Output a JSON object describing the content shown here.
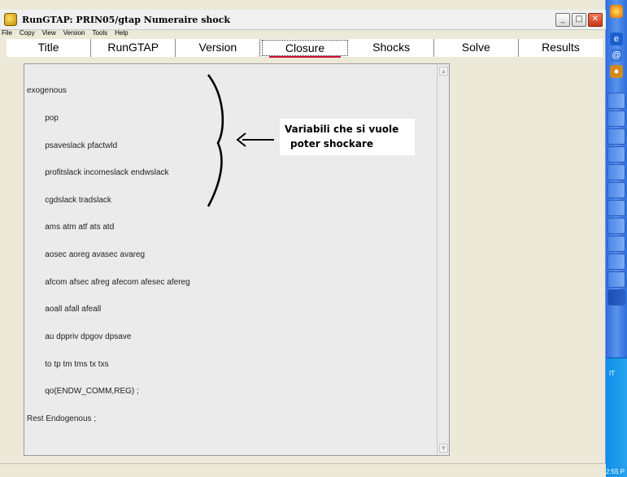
{
  "window": {
    "title": "RunGTAP: PRIN05/gtap  Numeraire shock",
    "controls": {
      "minimize": "_",
      "restore": "□",
      "close": "✕"
    }
  },
  "menu": [
    "File",
    "Copy",
    "View",
    "Version",
    "Tools",
    "Help"
  ],
  "tabs": [
    {
      "label": "Title",
      "active": false
    },
    {
      "label": "RunGTAP",
      "active": false
    },
    {
      "label": "Version",
      "active": false
    },
    {
      "label": "Closure",
      "active": true
    },
    {
      "label": "Shocks",
      "active": false
    },
    {
      "label": "Solve",
      "active": false
    },
    {
      "label": "Results",
      "active": false
    }
  ],
  "closure_text": [
    "exogenous",
    "        pop",
    "        psaveslack pfactwld",
    "        profitslack incomeslack endwslack",
    "        cgdslack tradslack",
    "        ams atm atf ats atd",
    "        aosec aoreg avasec avareg",
    "        afcom afsec afreg afecom afesec afereg",
    "        aoall afall afeall",
    "        au dppriv dpgov dpsave",
    "        to tp tm tms tx txs",
    "        qo(ENDW_COMM,REG) ;",
    "Rest Endogenous ;"
  ],
  "annotation": {
    "line1": "Variabili che si vuole",
    "line2": "poter shockare"
  },
  "taskbar": {
    "language": "IT",
    "clock": "2:55 P"
  },
  "colors": {
    "window_bg": "#ece9d8",
    "active_tab_underline": "#c8102e",
    "taskbar_blue": "#2f6fdb",
    "tray_blue": "#0f8fe8"
  }
}
